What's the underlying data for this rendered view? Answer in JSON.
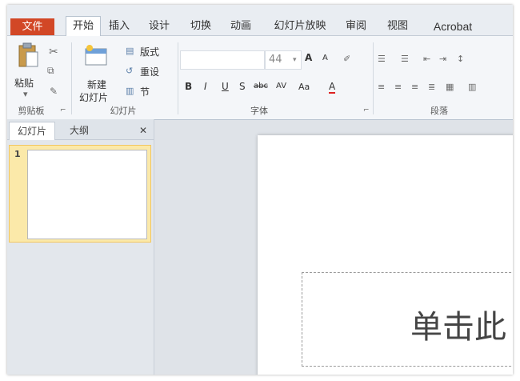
{
  "tabs": {
    "file": "文件",
    "home": "开始",
    "insert": "插入",
    "design": "设计",
    "transitions": "切换",
    "animations": "动画",
    "slideshow": "幻灯片放映",
    "review": "审阅",
    "view": "视图",
    "acrobat": "Acrobat"
  },
  "clipboard": {
    "paste_label": "粘贴",
    "group_label": "剪贴板"
  },
  "slides": {
    "new_slide_line1": "新建",
    "new_slide_line2": "幻灯片",
    "layout_label": "版式",
    "reset_label": "重设",
    "section_label": "节",
    "group_label": "幻灯片"
  },
  "font": {
    "size_value": "44",
    "bold": "B",
    "italic": "I",
    "underline": "U",
    "shadow": "S",
    "strike": "abc",
    "spacing": "AV",
    "case": "Aa",
    "color": "A",
    "grow": "A",
    "shrink": "A",
    "group_label": "字体"
  },
  "paragraph": {
    "group_label": "段落"
  },
  "panel": {
    "tab_slides": "幻灯片",
    "tab_outline": "大纲",
    "close": "✕",
    "slide_number": "1"
  },
  "slide": {
    "placeholder_text": "单击此"
  }
}
